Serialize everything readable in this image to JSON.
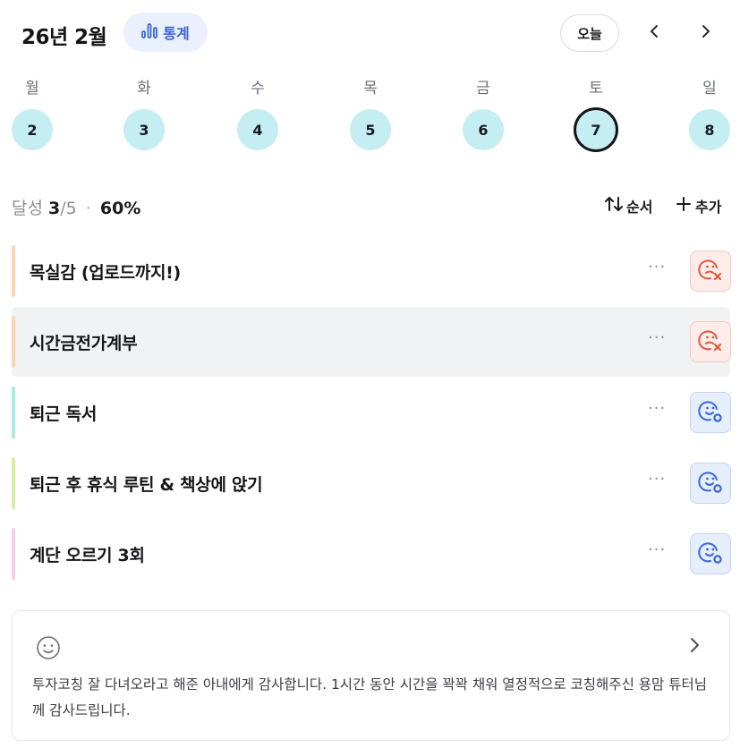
{
  "header": {
    "month_title": "26년 2월",
    "stats_label": "통계",
    "today_label": "오늘"
  },
  "week": {
    "days": [
      {
        "weekday": "월",
        "date": "2"
      },
      {
        "weekday": "화",
        "date": "3"
      },
      {
        "weekday": "수",
        "date": "4"
      },
      {
        "weekday": "목",
        "date": "5"
      },
      {
        "weekday": "금",
        "date": "6"
      },
      {
        "weekday": "토",
        "date": "7"
      },
      {
        "weekday": "일",
        "date": "8"
      }
    ],
    "selected_date": "7"
  },
  "summary": {
    "label": "달성",
    "achieved": "3",
    "total": "/5",
    "separator": "·",
    "percent": "60%",
    "order_label": "순서",
    "add_label": "추가"
  },
  "habits": [
    {
      "name": "목실감 (업로드까지!)",
      "accent": "#fbd6ab",
      "status": "fail",
      "more": "···"
    },
    {
      "name": "시간금전가계부",
      "accent": "#fbd6ab",
      "status": "fail",
      "more": "···"
    },
    {
      "name": "퇴근 독서",
      "accent": "#a9ece0",
      "status": "ok",
      "more": "···"
    },
    {
      "name": "퇴근 후 휴식 루틴 & 책상에 앉기",
      "accent": "#d6efa6",
      "status": "ok",
      "more": "···"
    },
    {
      "name": "계단 오르기 3회",
      "accent": "#f9cde3",
      "status": "ok",
      "more": "···"
    }
  ],
  "gratitude": {
    "text": "투자코칭 잘 다녀오라고 해준 아내에게 감사합니다. 1시간 동안 시간을 꽉꽉 채워 열정적으로 코칭해주신 용맘 튜터님께 감사드립니다."
  },
  "colors": {
    "accent_blue": "#3a66d6",
    "day_circle": "#c4eef2",
    "fail_red": "#e2573f",
    "ok_blue": "#3a66d6"
  },
  "icons": {
    "stats": "bar-chart-icon",
    "prev": "chevron-left-icon",
    "next": "chevron-right-icon",
    "order": "sort-arrows-icon",
    "add": "plus-icon",
    "fail": "sad-face-x-icon",
    "ok": "smile-face-check-icon",
    "card": "smile-icon",
    "card_chevron": "chevron-right-icon"
  }
}
